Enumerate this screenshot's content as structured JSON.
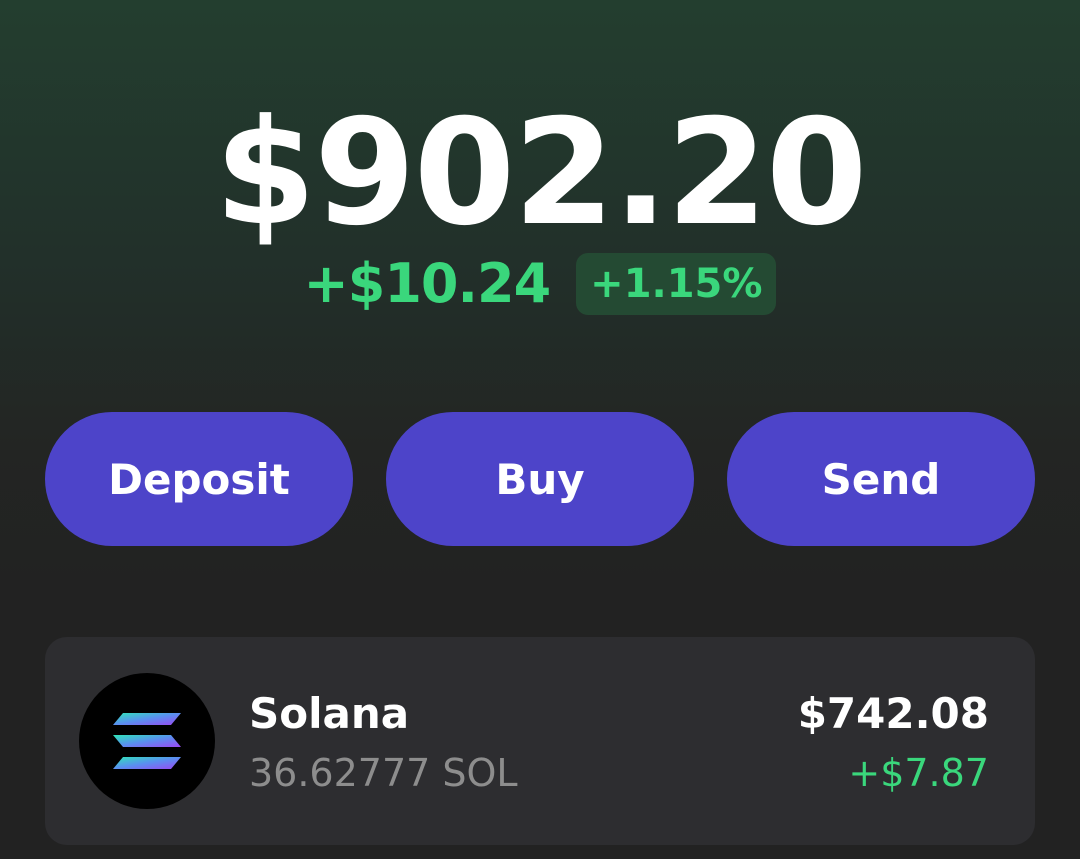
{
  "balance": {
    "total": "$902.20",
    "change_amount": "+$10.24",
    "change_percent": "+1.15%"
  },
  "actions": {
    "deposit": "Deposit",
    "buy": "Buy",
    "send": "Send"
  },
  "tokens": [
    {
      "name": "Solana",
      "amount": "36.62777 SOL",
      "value": "$742.08",
      "change": "+$7.87",
      "icon": "solana-logo-icon"
    }
  ],
  "colors": {
    "accent": "#4d44c9",
    "positive": "#3ad77c",
    "positive_badge_bg": "#244a33",
    "card_bg": "#2d2d30"
  }
}
